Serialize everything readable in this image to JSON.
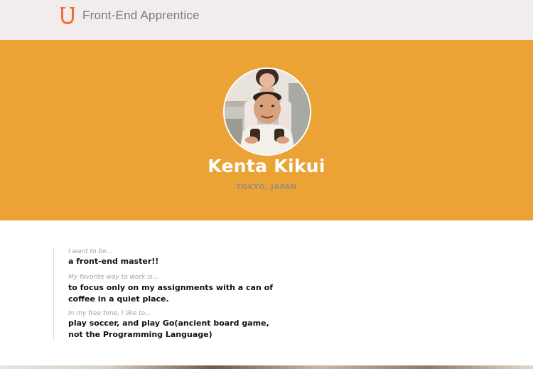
{
  "header": {
    "logo_icon": "udacity-u-logo-icon",
    "brand": "Front-End Apprentice"
  },
  "profile": {
    "photo": "profile-photo",
    "name": "Kenta Kikui",
    "location": "TOKYO, JAPAN"
  },
  "about": {
    "q1": "I want to be...",
    "a1": "a front-end master!!",
    "q2": "My favorite way to work is...",
    "a2": "to focus only on my assignments with a can of coffee in a quiet place.",
    "q3": "In my free time, I like to...",
    "a3": "play soccer, and play Go(ancient board game, not the Programming Language)"
  },
  "colors": {
    "header_bg": "#f2eced",
    "hero_bg": "#eca336",
    "logo_orange": "#f26f33",
    "name_color": "#ffffff",
    "location_color": "#9c8d80"
  }
}
